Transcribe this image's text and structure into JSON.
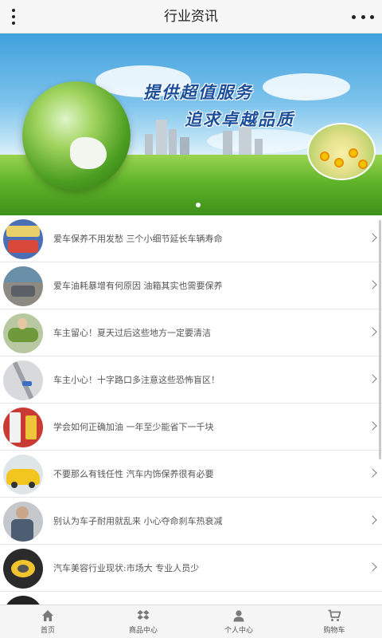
{
  "header": {
    "title": "行业资讯"
  },
  "banner": {
    "slogan_line1": "提供超值服务",
    "slogan_line2": "追求卓越品质",
    "slide_count": 1,
    "active_slide": 1
  },
  "news": [
    {
      "title": "爱车保养不用发愁 三个小细节延长车辆寿命",
      "icon": "car-interior-thumb"
    },
    {
      "title": "爱车油耗暴增有何原因 油箱其实也需要保养",
      "icon": "car-road-thumb"
    },
    {
      "title": "车主留心！夏天过后这些地方一定要清洁",
      "icon": "car-wash-thumb"
    },
    {
      "title": "车主小心！十字路口多注意这些恐怖盲区！",
      "icon": "road-map-thumb"
    },
    {
      "title": "学会如何正确加油 一年至少能省下一千块",
      "icon": "fuel-station-thumb"
    },
    {
      "title": "不要那么有钱任性 汽车内饰保养很有必要",
      "icon": "yellow-car-thumb"
    },
    {
      "title": "别认为车子耐用就乱来 小心夺命刹车热衰减",
      "icon": "mechanic-thumb"
    },
    {
      "title": "汽车美容行业现状:市场大 专业人员少",
      "icon": "polishing-thumb"
    }
  ],
  "tabbar": [
    {
      "label": "首页",
      "icon": "home-icon"
    },
    {
      "label": "商品中心",
      "icon": "box-icon"
    },
    {
      "label": "个人中心",
      "icon": "user-icon"
    },
    {
      "label": "购物车",
      "icon": "cart-icon"
    }
  ],
  "colors": {
    "slogan": "#1b4f9a",
    "tab_icon": "#7a7a7a"
  }
}
